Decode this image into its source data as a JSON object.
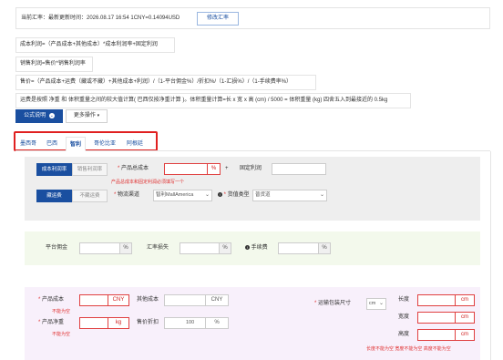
{
  "rate_info": {
    "text": "当前汇率：最新更新时间：2026.08.17 16:54 1CNY=0.14094USD",
    "modify_button": "修改汇率"
  },
  "formulas": {
    "cost_profit": "成本利润=（产品成本+其他成本）*成本利润率+固定利润",
    "sale_profit": "销售利润=售价*销售利润率",
    "price": "售价=（产品成本+运费（藏或不藏）+其他成本+利润）/（1-平台佣金%）/折扣%/（1-汇损%）/（1-手续费率%）",
    "shipping": "运费是按照 净重 和 体积重量之间的较大值计算( 巴西仅按净重计算 )。体积重量计算=长 x 宽 x 高 (cm) / 5000 = 体积重量 (kg) 四舍五入到最接近的 0.5kg"
  },
  "toolbar": {
    "formula_button": "公式说明",
    "more_button": "更多操作"
  },
  "tabs": [
    "墨西哥",
    "巴西",
    "智利",
    "哥伦比亚",
    "阿根廷"
  ],
  "active_tab_index": 2,
  "profit_section": {
    "profit_type_options": [
      "成本利润率",
      "销售利润率"
    ],
    "product_cost_label": "产品总成本",
    "percent_unit": "%",
    "plus": "+",
    "fixed_profit_label": "固定利润",
    "error_text": "产品总成本和固定利润必须填写一个",
    "freight_options": [
      "藏运费",
      "不藏运费"
    ],
    "channel_label": "物流渠道",
    "channel_value": "智利MallAmerica",
    "goods_type_label": "货值类型",
    "goods_type_value": "普货道"
  },
  "fees_section": {
    "commission_label": "平台佣金",
    "exchange_loss_label": "汇率损失",
    "fee_label": "手续费",
    "percent_unit": "%"
  },
  "product_section": {
    "product_cost_label": "产品成本",
    "product_cost_unit": "CNY",
    "product_cost_error": "不能为空",
    "other_cost_label": "其他成本",
    "other_cost_unit": "CNY",
    "net_weight_label": "产品净重",
    "net_weight_unit": "kg",
    "net_weight_error": "不能为空",
    "discount_label": "售价折扣",
    "discount_value": "100",
    "discount_unit": "%",
    "package_label": "运输包装尺寸",
    "package_unit_select": "cm",
    "length_label": "长度",
    "width_label": "宽度",
    "height_label": "高度",
    "dim_unit": "cm",
    "dim_errors": "长度不能为空  宽度不能为空  高度不能为空"
  },
  "colors": {
    "primary": "#1a4fa0",
    "error": "#e03030",
    "tab_highlight_border": "#e02020",
    "section_gray": "#eeeeee",
    "section_green": "#f3f9ec",
    "section_purple": "#f8f0fb"
  },
  "icons": {
    "formula_button_icon": "chevron-circle-down-icon",
    "more_button_icon": "caret-down-icon",
    "goods_type_icon": "info-circle-icon",
    "fee_icon": "info-circle-icon"
  }
}
